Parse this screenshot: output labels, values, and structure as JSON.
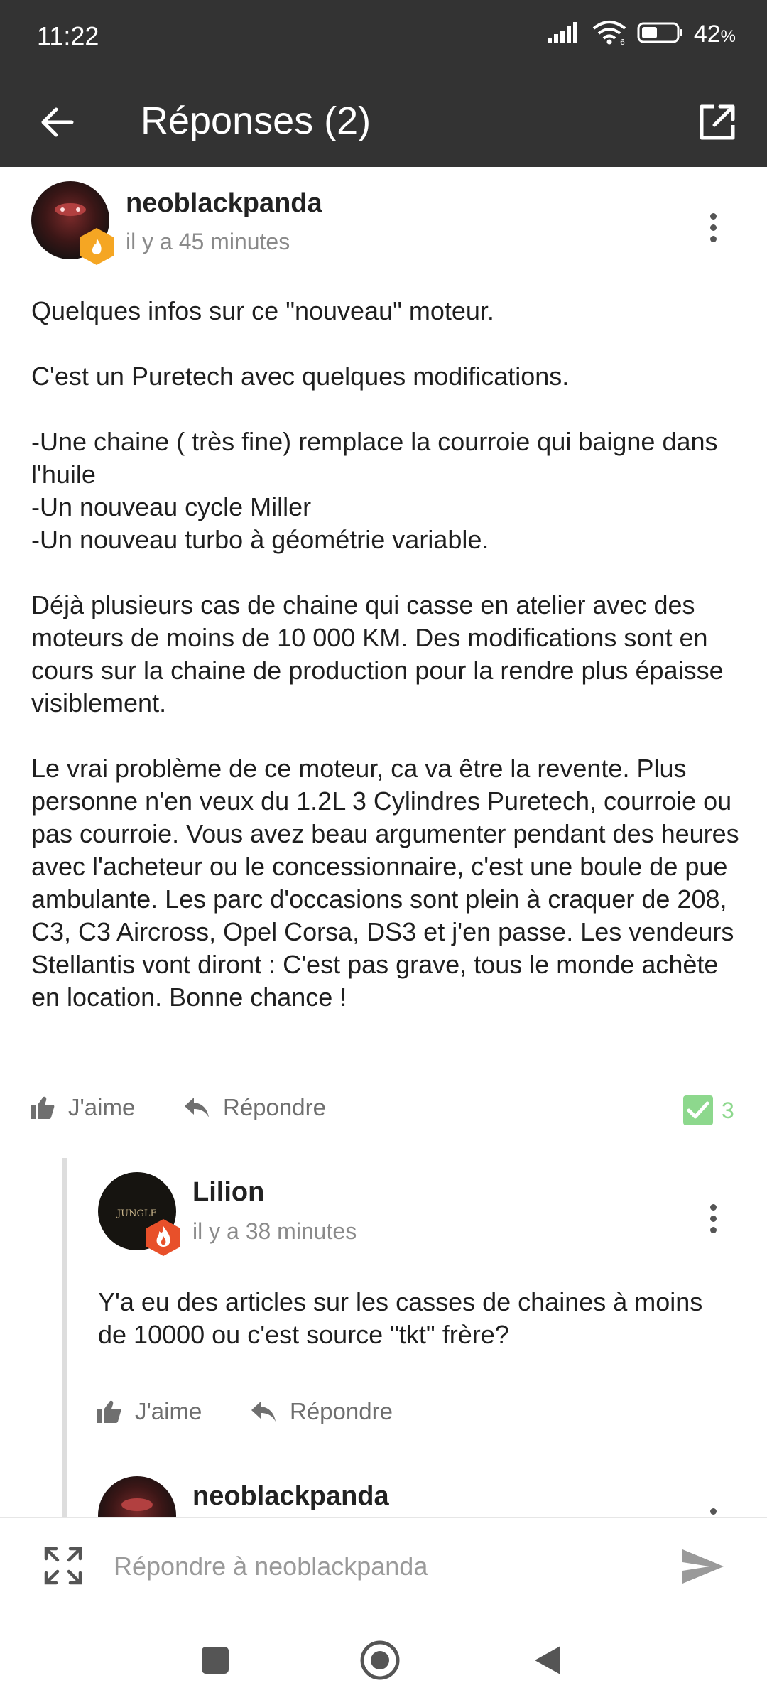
{
  "status_bar": {
    "time": "11:22",
    "battery_percent": "42",
    "battery_unit": "%"
  },
  "app_bar": {
    "title": "Réponses (2)"
  },
  "posts": [
    {
      "author": "neoblackpanda",
      "time": "il y a 45 minutes",
      "body": "Quelques infos sur ce \"nouveau\" moteur.\n\nC'est un Puretech avec quelques modifications.\n\n-Une chaine ( très fine) remplace la courroie qui baigne dans l'huile\n-Un nouveau cycle Miller\n-Un nouveau turbo à géométrie variable.\n\nDéjà plusieurs cas de chaine qui casse en atelier avec des moteurs de moins de 10 000 KM. Des modifications sont en cours sur la chaine de production pour la rendre plus épaisse visiblement.\n\nLe vrai problème de ce moteur, ca va être la revente. Plus personne n'en veux du 1.2L 3 Cylindres Puretech, courroie ou pas courroie. Vous avez beau argumenter pendant des heures avec l'acheteur ou le concessionnaire, c'est une boule de pue ambulante. Les parc d'occasions sont plein à craquer de 208, C3, C3 Aircross, Opel Corsa, DS3 et j'en passe. Les vendeurs Stellantis vont diront : C'est pas grave, tous le monde achète en location.  Bonne chance !",
      "like_label": "J'aime",
      "reply_label": "Répondre",
      "check_count": "3"
    },
    {
      "author": "Lilion",
      "time": "il y a 38 minutes",
      "body": "Y'a eu des articles sur les casses de chaines à moins de 10000 ou c'est source \"tkt\" frère?",
      "like_label": "J'aime",
      "reply_label": "Répondre",
      "avatar_text": "JUNGLE"
    },
    {
      "author": "neoblackpanda"
    }
  ],
  "reply_bar": {
    "placeholder": "Répondre à neoblackpanda"
  },
  "colors": {
    "app_bar_bg": "#333333",
    "check_green": "#8dd88d",
    "badge_orange": "#f5a623",
    "badge_red": "#e8502a"
  }
}
